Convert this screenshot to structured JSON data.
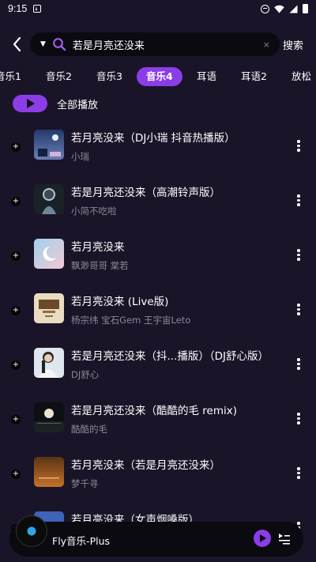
{
  "status_bar": {
    "time": "9:15"
  },
  "search": {
    "query": "若是月亮还没来",
    "button_label": "搜索"
  },
  "tabs": [
    {
      "label": "音乐1"
    },
    {
      "label": "音乐2"
    },
    {
      "label": "音乐3"
    },
    {
      "label": "音乐4",
      "active": true
    },
    {
      "label": "耳语"
    },
    {
      "label": "耳语2"
    },
    {
      "label": "放松"
    }
  ],
  "play_all": {
    "label": "全部播放"
  },
  "songs": [
    {
      "title": "若月亮没来（DJ小瑞 抖音热播版）",
      "artist": "小瑞"
    },
    {
      "title": "若是月亮还没来（高潮铃声版）",
      "artist": "小简不吃啦"
    },
    {
      "title": "若月亮没来",
      "artist": "飘渺哥哥 棠若"
    },
    {
      "title": "若月亮没来 (Live版)",
      "artist": "杨宗纬 宝石Gem 王宇宙Leto"
    },
    {
      "title": "若是月亮还没来（抖...播版）（DJ舒心版）",
      "artist": "DJ舒心"
    },
    {
      "title": "若是月亮还没来（酷酷的毛 remix)",
      "artist": "酷酷的毛"
    },
    {
      "title": "若月亮没来（若是月亮还没来）",
      "artist": "梦千寻"
    },
    {
      "title": "若月亮没来（女声烟嗓版）",
      "artist": ""
    }
  ],
  "player": {
    "title": "Fly音乐-Plus"
  },
  "colors": {
    "accent": "#8b3de8",
    "background": "#1a1429",
    "secondary_text": "#8c8797"
  }
}
